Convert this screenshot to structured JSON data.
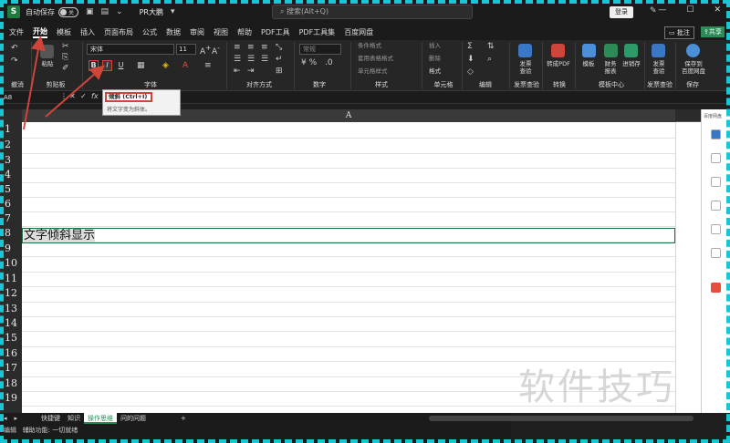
{
  "titlebar": {
    "app_icon": "S",
    "autosave_label": "自动保存",
    "autosave_state": "关",
    "doc_name": "PR大鹏",
    "search_placeholder": "搜索(Alt+Q)",
    "login_label": "登录"
  },
  "menubar": {
    "items": [
      "文件",
      "开始",
      "模板",
      "插入",
      "页面布局",
      "公式",
      "数据",
      "审阅",
      "视图",
      "帮助",
      "PDF工具",
      "PDF工具集",
      "百度网盘"
    ],
    "active": "开始",
    "comment_label": "批注",
    "share_label": "共享"
  },
  "ribbon": {
    "font_name": "宋体",
    "font_size": "11",
    "number_format": "常规",
    "bold_label": "B",
    "italic_label": "I",
    "underline_label": "U",
    "paste_label": "粘贴",
    "groups": {
      "undo": "撤消",
      "clipboard": "剪贴板",
      "font": "字体",
      "alignment": "对齐方式",
      "number": "数字",
      "styles": "样式",
      "cells": "单元格",
      "editing": "编辑",
      "invoice1": "发票查验",
      "convert": "转换",
      "template_center": "模板中心",
      "invoice2": "发票查验",
      "save": "保存"
    },
    "style_items": [
      "条件格式",
      "套用表格格式",
      "单元格样式"
    ],
    "cell_items": [
      "插入",
      "删除",
      "格式"
    ],
    "big_buttons": {
      "invoice_check": "发票\n查验",
      "to_pdf": "转成PDF",
      "template": "模板",
      "finance": "财务\n报表",
      "inventory": "进销存",
      "invoice_check2": "发票\n查验",
      "save_baidu": "保存到\n百度网盘"
    }
  },
  "formula_bar": {
    "name_box": "A8",
    "fx": "fx"
  },
  "tooltip": {
    "title": "倾斜 (Ctrl+I)",
    "description": "将文字变为斜体。"
  },
  "sheet": {
    "column_header": "A",
    "row_numbers": [
      "1",
      "2",
      "3",
      "4",
      "5",
      "6",
      "7",
      "8",
      "9",
      "10",
      "11",
      "12",
      "13",
      "14",
      "15",
      "16",
      "17",
      "18",
      "19"
    ],
    "cell_a8_text": "文字倾斜显示"
  },
  "sheet_tabs": {
    "tabs": [
      "快捷键",
      "知识",
      "操作思维",
      "问的问题"
    ],
    "active": "操作思维",
    "add_icon": "+"
  },
  "statusbar": {
    "mode": "编辑",
    "accessibility": "辅助功能: 一切就绪"
  },
  "sidebar": {
    "label": "百度网盘"
  },
  "watermark": "软件技巧"
}
